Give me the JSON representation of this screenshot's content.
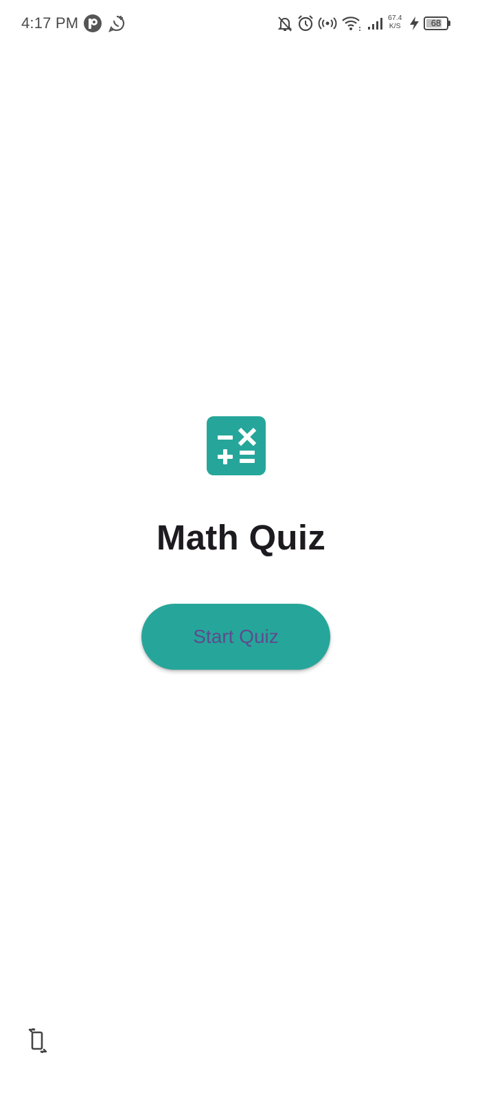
{
  "status_bar": {
    "time": "4:17 PM",
    "net_speed_value": "67.4",
    "net_speed_unit": "K/S",
    "battery_level": "68",
    "icons": [
      "app-notification-icon",
      "whatsapp-icon",
      "mute-icon",
      "alarm-icon",
      "hotspot-icon",
      "wifi-icon",
      "signal-icon",
      "charging-icon",
      "battery-icon"
    ]
  },
  "app": {
    "logo_icon": "calculator-icon",
    "title": "Math Quiz",
    "start_button_label": "Start Quiz"
  },
  "colors": {
    "accent": "#26a69a",
    "button_text": "#5e4a8e",
    "title_text": "#1d1b20"
  },
  "bottom": {
    "rotate_icon": "screen-rotate-icon"
  }
}
